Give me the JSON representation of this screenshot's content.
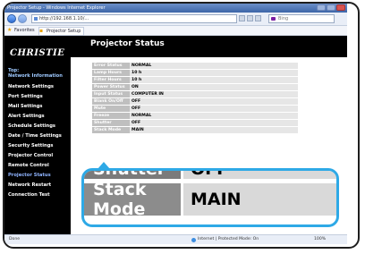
{
  "browser": {
    "title_bar": "Projector Setup - Windows Internet Explorer",
    "address": "http://192.168.1.10/...",
    "search_placeholder": "Bing",
    "favorites": [
      {
        "label": "Favorites"
      },
      {
        "label": "Projector Setup"
      }
    ],
    "status_left": "Done",
    "status_zone": "Internet | Protected Mode: On",
    "status_zoom": "100%"
  },
  "sidebar": {
    "logo": "CHRISTIE",
    "items": [
      {
        "label": "Top:"
      },
      {
        "label": "Network Information"
      },
      {
        "label": "Network Settings"
      },
      {
        "label": "Port Settings"
      },
      {
        "label": "Mail Settings"
      },
      {
        "label": "Alert Settings"
      },
      {
        "label": "Schedule Settings"
      },
      {
        "label": "Date / Time Settings"
      },
      {
        "label": "Security Settings"
      },
      {
        "label": "Projector Control"
      },
      {
        "label": "Remote Control"
      },
      {
        "label": "Projector Status"
      },
      {
        "label": "Network Restart"
      },
      {
        "label": "Connection Test"
      }
    ]
  },
  "content": {
    "title": "Projector Status",
    "rows": [
      {
        "key": "Error Status",
        "value": "NORMAL"
      },
      {
        "key": "Lamp Hours",
        "value": "10 h"
      },
      {
        "key": "Filter Hours",
        "value": "10 h"
      },
      {
        "key": "Power Status",
        "value": "ON"
      },
      {
        "key": "Input Status",
        "value": "COMPUTER IN"
      },
      {
        "key": "Blank On/Off",
        "value": "OFF"
      },
      {
        "key": "Mute",
        "value": "OFF"
      },
      {
        "key": "Freeze",
        "value": "NORMAL"
      },
      {
        "key": "Shutter",
        "value": "OFF"
      },
      {
        "key": "Stack Mode",
        "value": "MAIN"
      }
    ]
  },
  "zoom": {
    "rows": [
      {
        "key": "Shutter",
        "value": "OFF"
      },
      {
        "key": "Stack Mode",
        "value": "MAIN"
      }
    ]
  },
  "colors": {
    "callout": "#2ea9e6",
    "sidebar_bg": "#000000",
    "active_nav": "#8fb4ff"
  }
}
